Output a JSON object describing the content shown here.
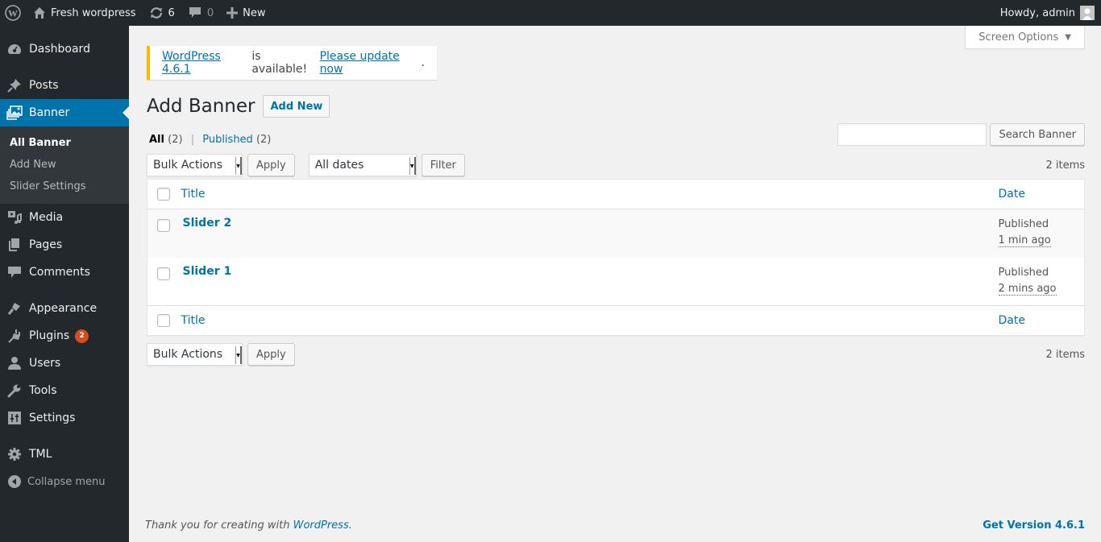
{
  "adminbar": {
    "site_name": "Fresh wordpress",
    "updates_count": "6",
    "comments_count": "0",
    "new_label": "New",
    "greeting": "Howdy, admin"
  },
  "sidebar": {
    "items": [
      {
        "label": "Dashboard",
        "icon": "dashboard-icon"
      },
      {
        "label": "Posts",
        "icon": "pin-icon"
      },
      {
        "label": "Banner",
        "icon": "images-icon",
        "current": true
      },
      {
        "label": "Media",
        "icon": "media-icon"
      },
      {
        "label": "Pages",
        "icon": "pages-icon"
      },
      {
        "label": "Comments",
        "icon": "comment-icon"
      },
      {
        "label": "Appearance",
        "icon": "paintbrush-icon"
      },
      {
        "label": "Plugins",
        "icon": "plugin-icon",
        "badge": "2"
      },
      {
        "label": "Users",
        "icon": "user-icon"
      },
      {
        "label": "Tools",
        "icon": "wrench-icon"
      },
      {
        "label": "Settings",
        "icon": "settings-icon"
      },
      {
        "label": "TML",
        "icon": "gear-icon"
      }
    ],
    "submenu": [
      {
        "label": "All Banner",
        "current": true
      },
      {
        "label": "Add New"
      },
      {
        "label": "Slider Settings"
      }
    ],
    "collapse_label": "Collapse menu"
  },
  "screen_options": {
    "label": "Screen Options"
  },
  "notice": {
    "version_link": "WordPress 4.6.1",
    "middle_text": "is available!",
    "update_link": "Please update now",
    "end": "."
  },
  "page": {
    "title": "Add Banner",
    "add_new_label": "Add New"
  },
  "views": {
    "all_label": "All",
    "all_count": "(2)",
    "separator": "|",
    "published_label": "Published",
    "published_count": "(2)"
  },
  "search": {
    "value": "",
    "button_label": "Search Banner"
  },
  "tablenav_top": {
    "bulk_actions": "Bulk Actions",
    "apply_label": "Apply",
    "date_filter": "All dates",
    "filter_label": "Filter",
    "items_count": "2 items"
  },
  "table": {
    "columns": {
      "title": "Title",
      "date": "Date"
    },
    "rows": [
      {
        "title": "Slider 2",
        "status": "Published",
        "date": "1 min ago"
      },
      {
        "title": "Slider 1",
        "status": "Published",
        "date": "2 mins ago"
      }
    ]
  },
  "tablenav_bottom": {
    "bulk_actions": "Bulk Actions",
    "apply_label": "Apply",
    "items_count": "2 items"
  },
  "footer": {
    "thanks_text": "Thank you for creating with",
    "wordpress_link": "WordPress",
    "thanks_end": ".",
    "version_link": "Get Version 4.6.1"
  }
}
